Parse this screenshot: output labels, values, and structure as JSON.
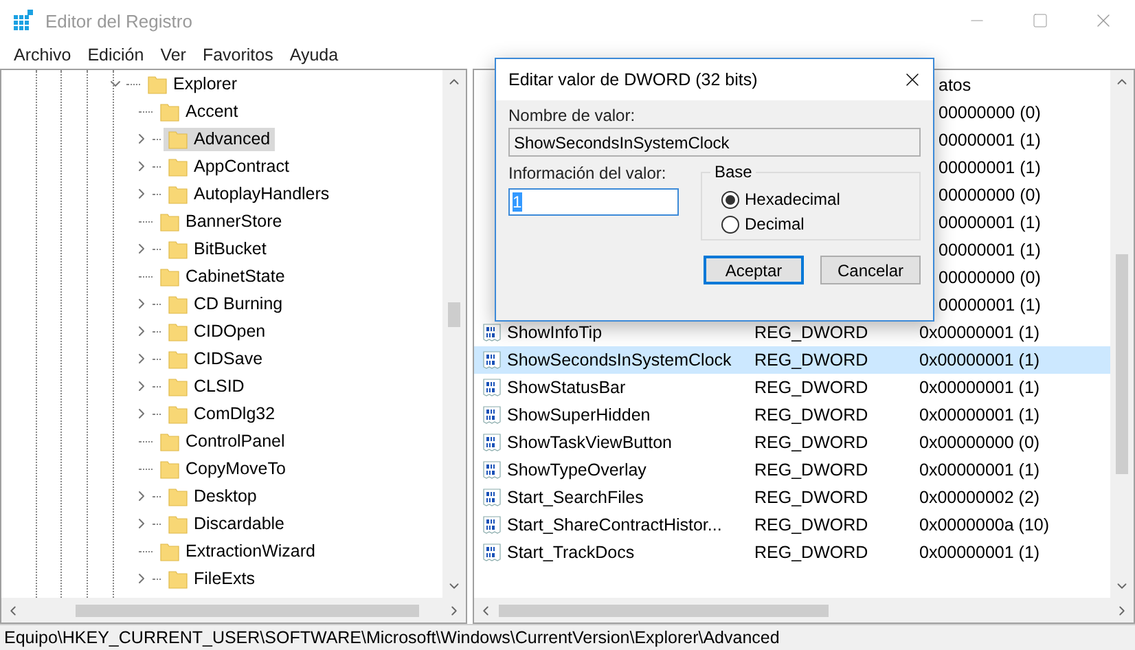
{
  "window": {
    "title": "Editor del Registro"
  },
  "menu": [
    "Archivo",
    "Edición",
    "Ver",
    "Favoritos",
    "Ayuda"
  ],
  "tree": [
    {
      "label": "Explorer",
      "expanded": true,
      "selected": false,
      "children": [
        {
          "label": "Accent",
          "expandable": false,
          "selected": false
        },
        {
          "label": "Advanced",
          "expandable": true,
          "selected": true
        },
        {
          "label": "AppContract",
          "expandable": true,
          "selected": false
        },
        {
          "label": "AutoplayHandlers",
          "expandable": true,
          "selected": false
        },
        {
          "label": "BannerStore",
          "expandable": false,
          "selected": false
        },
        {
          "label": "BitBucket",
          "expandable": true,
          "selected": false
        },
        {
          "label": "CabinetState",
          "expandable": false,
          "selected": false
        },
        {
          "label": "CD Burning",
          "expandable": true,
          "selected": false
        },
        {
          "label": "CIDOpen",
          "expandable": true,
          "selected": false
        },
        {
          "label": "CIDSave",
          "expandable": true,
          "selected": false
        },
        {
          "label": "CLSID",
          "expandable": true,
          "selected": false
        },
        {
          "label": "ComDlg32",
          "expandable": true,
          "selected": false
        },
        {
          "label": "ControlPanel",
          "expandable": false,
          "selected": false
        },
        {
          "label": "CopyMoveTo",
          "expandable": false,
          "selected": false
        },
        {
          "label": "Desktop",
          "expandable": true,
          "selected": false
        },
        {
          "label": "Discardable",
          "expandable": true,
          "selected": false
        },
        {
          "label": "ExtractionWizard",
          "expandable": false,
          "selected": false
        },
        {
          "label": "FileExts",
          "expandable": true,
          "selected": false
        }
      ]
    }
  ],
  "table": {
    "columns": [
      "atos"
    ],
    "rows": [
      {
        "kind": "covered",
        "data": "00000000 (0)",
        "selected": false
      },
      {
        "kind": "covered",
        "data": "00000001 (1)",
        "selected": false
      },
      {
        "kind": "covered",
        "data": "00000001 (1)",
        "selected": false
      },
      {
        "kind": "covered",
        "data": "00000000 (0)",
        "selected": false
      },
      {
        "kind": "covered",
        "data": "00000001 (1)",
        "selected": false
      },
      {
        "kind": "covered",
        "data": "00000001 (1)",
        "selected": false
      },
      {
        "kind": "covered",
        "data": "00000000 (0)",
        "selected": false
      },
      {
        "kind": "covered",
        "data": "00000001 (1)",
        "selected": false
      },
      {
        "kind": "full",
        "name": "ShowInfoTip",
        "type": "REG_DWORD",
        "data": "0x00000001 (1)",
        "selected": false
      },
      {
        "kind": "full",
        "name": "ShowSecondsInSystemClock",
        "type": "REG_DWORD",
        "data": "0x00000001 (1)",
        "selected": true
      },
      {
        "kind": "full",
        "name": "ShowStatusBar",
        "type": "REG_DWORD",
        "data": "0x00000001 (1)",
        "selected": false
      },
      {
        "kind": "full",
        "name": "ShowSuperHidden",
        "type": "REG_DWORD",
        "data": "0x00000001 (1)",
        "selected": false
      },
      {
        "kind": "full",
        "name": "ShowTaskViewButton",
        "type": "REG_DWORD",
        "data": "0x00000000 (0)",
        "selected": false
      },
      {
        "kind": "full",
        "name": "ShowTypeOverlay",
        "type": "REG_DWORD",
        "data": "0x00000001 (1)",
        "selected": false
      },
      {
        "kind": "full",
        "name": "Start_SearchFiles",
        "type": "REG_DWORD",
        "data": "0x00000002 (2)",
        "selected": false
      },
      {
        "kind": "full",
        "name": "Start_ShareContractHistor...",
        "type": "REG_DWORD",
        "data": "0x0000000a (10)",
        "selected": false
      },
      {
        "kind": "full",
        "name": "Start_TrackDocs",
        "type": "REG_DWORD",
        "data": "0x00000001 (1)",
        "selected": false
      }
    ]
  },
  "dialog": {
    "title": "Editar valor de DWORD (32 bits)",
    "name_label": "Nombre de valor:",
    "name_value": "ShowSecondsInSystemClock",
    "value_label": "Información del valor:",
    "value": "1",
    "value_selected": true,
    "base": {
      "label": "Base",
      "options": [
        {
          "label": "Hexadecimal",
          "selected": true
        },
        {
          "label": "Decimal",
          "selected": false
        }
      ]
    },
    "buttons": [
      {
        "label": "Aceptar",
        "default": true
      },
      {
        "label": "Cancelar",
        "default": false
      }
    ]
  },
  "status_bar": "Equipo\\HKEY_CURRENT_USER\\SOFTWARE\\Microsoft\\Windows\\CurrentVersion\\Explorer\\Advanced"
}
